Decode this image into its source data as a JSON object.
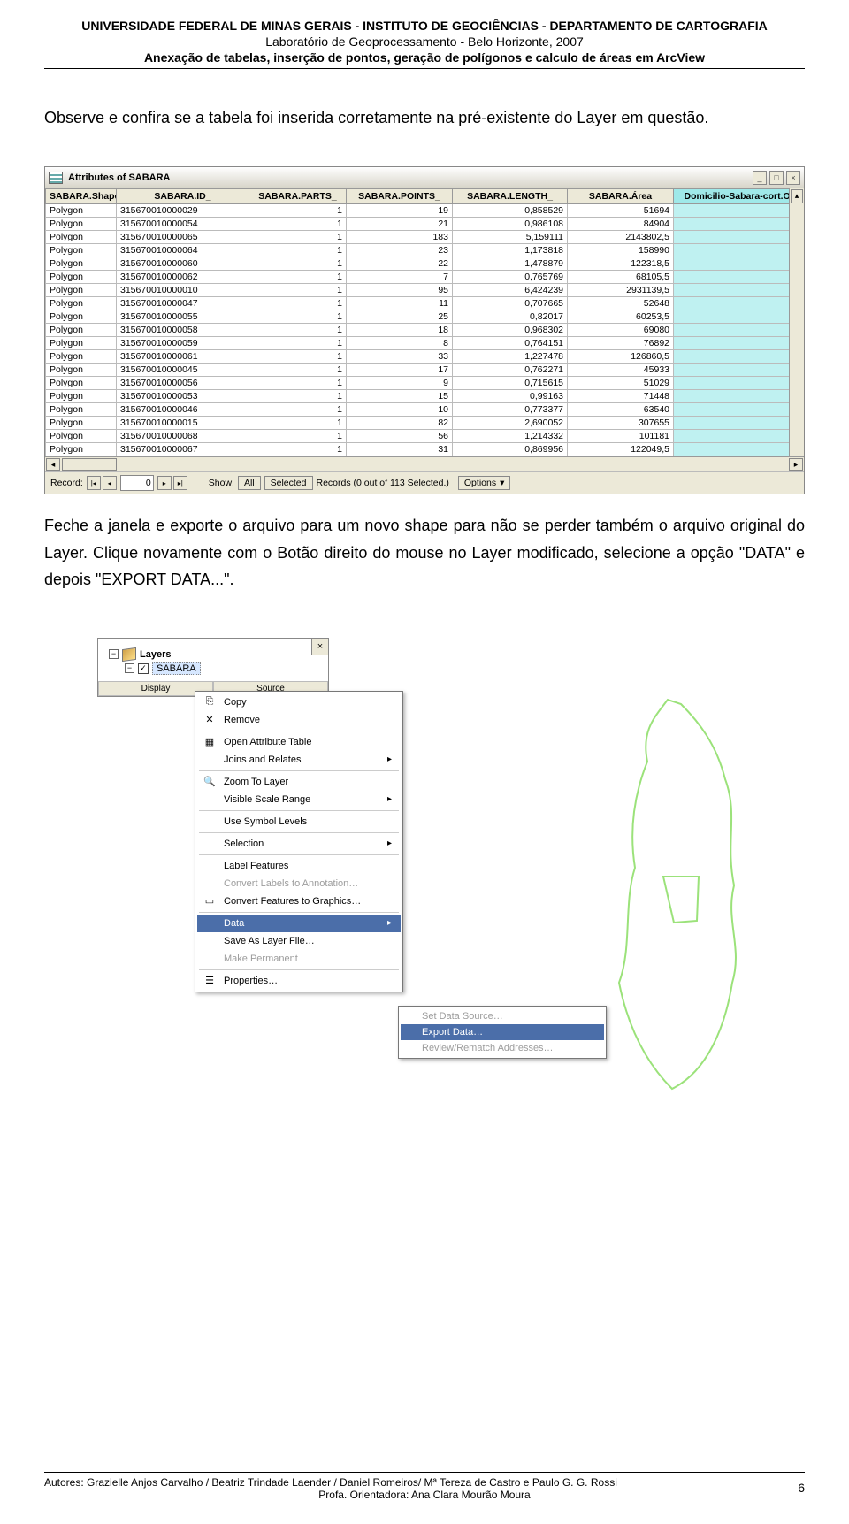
{
  "header": {
    "line1": "UNIVERSIDADE FEDERAL DE MINAS GERAIS - INSTITUTO DE GEOCIÊNCIAS - DEPARTAMENTO DE CARTOGRAFIA",
    "line2": "Laboratório de Geoprocessamento - Belo Horizonte, 2007",
    "line3": "Anexação de tabelas, inserção de pontos, geração de polígonos e calculo de áreas em ArcView"
  },
  "para1": "Observe e confira se a tabela foi inserida corretamente na pré-existente do Layer em questão.",
  "attributes": {
    "title": "Attributes of SABARA",
    "cols": [
      "SABARA.Shape",
      "SABARA.ID_",
      "SABARA.PARTS_",
      "SABARA.POINTS_",
      "SABARA.LENGTH_",
      "SABARA.Área",
      "Domicilio-Sabara-cort.OII"
    ],
    "rows": [
      [
        "Polygon",
        "315670010000029",
        "1",
        "19",
        "0,858529",
        "51694",
        ""
      ],
      [
        "Polygon",
        "315670010000054",
        "1",
        "21",
        "0,986108",
        "84904",
        ""
      ],
      [
        "Polygon",
        "315670010000065",
        "1",
        "183",
        "5,159111",
        "2143802,5",
        ""
      ],
      [
        "Polygon",
        "315670010000064",
        "1",
        "23",
        "1,173818",
        "158990",
        ""
      ],
      [
        "Polygon",
        "315670010000060",
        "1",
        "22",
        "1,478879",
        "122318,5",
        ""
      ],
      [
        "Polygon",
        "315670010000062",
        "1",
        "7",
        "0,765769",
        "68105,5",
        ""
      ],
      [
        "Polygon",
        "315670010000010",
        "1",
        "95",
        "6,424239",
        "2931139,5",
        ""
      ],
      [
        "Polygon",
        "315670010000047",
        "1",
        "11",
        "0,707665",
        "52648",
        ""
      ],
      [
        "Polygon",
        "315670010000055",
        "1",
        "25",
        "0,82017",
        "60253,5",
        ""
      ],
      [
        "Polygon",
        "315670010000058",
        "1",
        "18",
        "0,968302",
        "69080",
        ""
      ],
      [
        "Polygon",
        "315670010000059",
        "1",
        "8",
        "0,764151",
        "76892",
        ""
      ],
      [
        "Polygon",
        "315670010000061",
        "1",
        "33",
        "1,227478",
        "126860,5",
        ""
      ],
      [
        "Polygon",
        "315670010000045",
        "1",
        "17",
        "0,762271",
        "45933",
        ""
      ],
      [
        "Polygon",
        "315670010000056",
        "1",
        "9",
        "0,715615",
        "51029",
        ""
      ],
      [
        "Polygon",
        "315670010000053",
        "1",
        "15",
        "0,99163",
        "71448",
        ""
      ],
      [
        "Polygon",
        "315670010000046",
        "1",
        "10",
        "0,773377",
        "63540",
        ""
      ],
      [
        "Polygon",
        "315670010000015",
        "1",
        "82",
        "2,690052",
        "307655",
        ""
      ],
      [
        "Polygon",
        "315670010000068",
        "1",
        "56",
        "1,214332",
        "101181",
        ""
      ],
      [
        "Polygon",
        "315670010000067",
        "1",
        "31",
        "0,869956",
        "122049,5",
        ""
      ]
    ],
    "status": {
      "record_label": "Record:",
      "record_value": "0",
      "show_label": "Show:",
      "all": "All",
      "selected": "Selected",
      "count": "Records (0 out of 113 Selected.)",
      "options": "Options"
    }
  },
  "para2": "Feche a janela e exporte o arquivo para um novo shape para não se perder também o arquivo original do Layer. Clique novamente com o Botão direito do mouse no Layer modificado, selecione a opção \"DATA\" e depois \"EXPORT DATA...\".",
  "layers": {
    "title": "Layers",
    "item": "SABARA",
    "tab1": "Display",
    "tab2": "Source"
  },
  "context": [
    {
      "icon": "copy",
      "label": "Copy",
      "en": true
    },
    {
      "icon": "remove",
      "label": "Remove",
      "en": true
    },
    {
      "sep": true
    },
    {
      "icon": "table",
      "label": "Open Attribute Table",
      "en": true
    },
    {
      "icon": "",
      "label": "Joins and Relates",
      "en": true,
      "arrow": true
    },
    {
      "sep": true
    },
    {
      "icon": "zoom",
      "label": "Zoom To Layer",
      "en": true
    },
    {
      "icon": "",
      "label": "Visible Scale Range",
      "en": true,
      "arrow": true
    },
    {
      "sep": true
    },
    {
      "icon": "",
      "label": "Use Symbol Levels",
      "en": true
    },
    {
      "sep": true
    },
    {
      "icon": "",
      "label": "Selection",
      "en": true,
      "arrow": true
    },
    {
      "sep": true
    },
    {
      "icon": "",
      "label": "Label Features",
      "en": true
    },
    {
      "icon": "",
      "label": "Convert Labels to Annotation…",
      "en": false
    },
    {
      "icon": "conv",
      "label": "Convert Features to Graphics…",
      "en": true
    },
    {
      "sep": true
    },
    {
      "icon": "",
      "label": "Data",
      "en": true,
      "arrow": true,
      "sel": true
    },
    {
      "icon": "",
      "label": "Save As Layer File…",
      "en": true
    },
    {
      "icon": "",
      "label": "Make Permanent",
      "en": false
    },
    {
      "sep": true
    },
    {
      "icon": "props",
      "label": "Properties…",
      "en": true
    }
  ],
  "submenu": [
    {
      "label": "Set Data Source…",
      "en": false
    },
    {
      "label": "Export Data…",
      "en": true,
      "sel": true
    },
    {
      "label": "Review/Rematch Addresses…",
      "en": false
    }
  ],
  "footer": {
    "line1": "Autores: Grazielle Anjos Carvalho / Beatriz Trindade Laender / Daniel Romeiros/ Mª Tereza de Castro e Paulo G. G. Rossi",
    "line2": "Profa. Orientadora: Ana Clara Mourão Moura",
    "page": "6"
  }
}
